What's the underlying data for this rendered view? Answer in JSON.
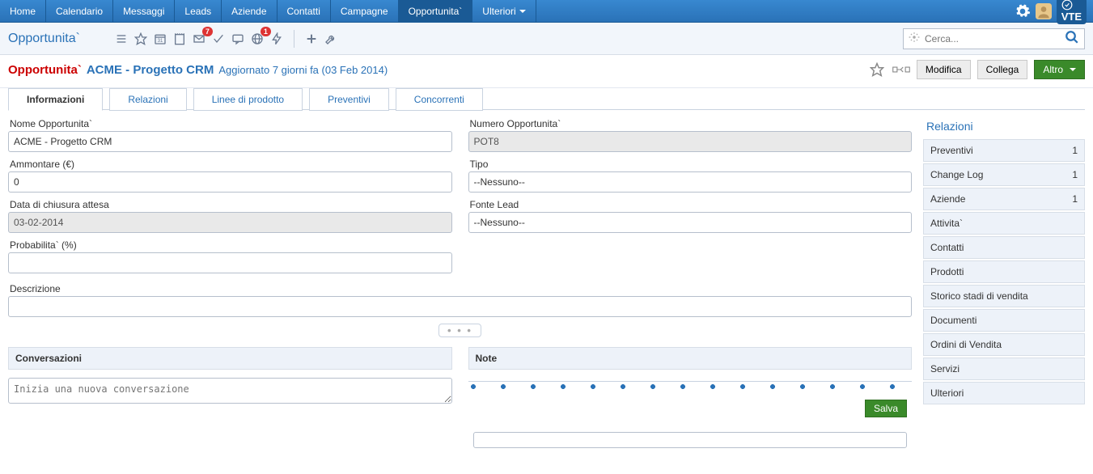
{
  "topnav": {
    "items": [
      "Home",
      "Calendario",
      "Messaggi",
      "Leads",
      "Aziende",
      "Contatti",
      "Campagne",
      "Opportunita`",
      "Ulteriori"
    ],
    "active_index": 7,
    "more_has_caret": true,
    "logo_text": "VTE"
  },
  "subbar": {
    "title": "Opportunita`",
    "search_placeholder": "Cerca...",
    "badges": {
      "mail": "7",
      "globe": "1"
    }
  },
  "record_header": {
    "module": "Opportunita`",
    "name": "ACME - Progetto CRM",
    "updated": "Aggiornato 7 giorni fa (03 Feb 2014)",
    "btn_edit": "Modifica",
    "btn_link": "Collega",
    "btn_more": "Altro"
  },
  "tabs": {
    "items": [
      "Informazioni",
      "Relazioni",
      "Linee di prodotto",
      "Preventivi",
      "Concorrenti"
    ],
    "active_index": 0
  },
  "fields": {
    "left": [
      {
        "label": "Nome Opportunita`",
        "value": "ACME - Progetto CRM",
        "readonly": false
      },
      {
        "label": "Ammontare (€)",
        "value": "0",
        "readonly": false
      },
      {
        "label": "Data di chiusura attesa",
        "value": "03-02-2014",
        "readonly": true
      },
      {
        "label": "Probabilita` (%)",
        "value": "",
        "readonly": false
      }
    ],
    "right": [
      {
        "label": "Numero Opportunita`",
        "value": "POT8",
        "readonly": true
      },
      {
        "label": "Tipo",
        "value": "--Nessuno--",
        "readonly": false
      },
      {
        "label": "Fonte Lead",
        "value": "--Nessuno--",
        "readonly": false
      }
    ],
    "description_label": "Descrizione",
    "description_value": ""
  },
  "panels": {
    "conversations": {
      "title": "Conversazioni",
      "placeholder": "Inizia una nuova conversazione"
    },
    "notes": {
      "title": "Note",
      "save": "Salva"
    }
  },
  "sidebar": {
    "title": "Relazioni",
    "items": [
      {
        "label": "Preventivi",
        "count": "1"
      },
      {
        "label": "Change Log",
        "count": "1"
      },
      {
        "label": "Aziende",
        "count": "1"
      },
      {
        "label": "Attivita`",
        "count": ""
      },
      {
        "label": "Contatti",
        "count": ""
      },
      {
        "label": "Prodotti",
        "count": ""
      },
      {
        "label": "Storico stadi di vendita",
        "count": ""
      },
      {
        "label": "Documenti",
        "count": ""
      },
      {
        "label": "Ordini di Vendita",
        "count": ""
      },
      {
        "label": "Servizi",
        "count": ""
      },
      {
        "label": "Ulteriori",
        "count": ""
      }
    ]
  }
}
